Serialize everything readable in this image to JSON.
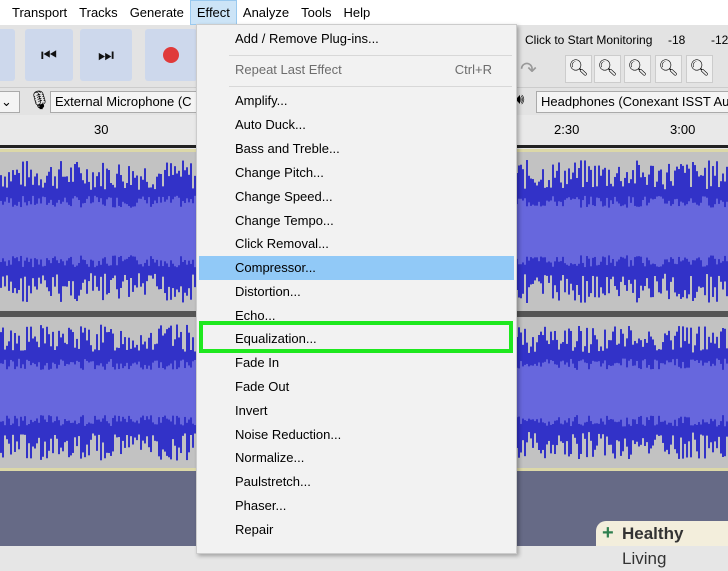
{
  "menubar": {
    "items": [
      "Transport",
      "Tracks",
      "Generate",
      "Effect",
      "Analyze",
      "Tools",
      "Help"
    ],
    "active": "Effect"
  },
  "toolbar": {
    "monitor_label": "Click to Start Monitoring",
    "meter_ticks": [
      "-18",
      "-12"
    ]
  },
  "devices": {
    "input": "External Microphone (C",
    "output": "Headphones (Conexant ISST Au"
  },
  "timeline": {
    "labels": [
      "30",
      "2:30",
      "3:00"
    ]
  },
  "effect_menu": {
    "items": [
      {
        "label": "Add / Remove Plug-ins..."
      },
      {
        "label": "Repeat Last Effect",
        "shortcut": "Ctrl+R",
        "disabled": true
      },
      {
        "label": "Amplify..."
      },
      {
        "label": "Auto Duck..."
      },
      {
        "label": "Bass and Treble..."
      },
      {
        "label": "Change Pitch..."
      },
      {
        "label": "Change Speed..."
      },
      {
        "label": "Change Tempo..."
      },
      {
        "label": "Click Removal..."
      },
      {
        "label": "Compressor...",
        "hovered": true
      },
      {
        "label": "Distortion..."
      },
      {
        "label": "Echo..."
      },
      {
        "label": "Equalization...",
        "highlighted_box": true
      },
      {
        "label": "Fade In"
      },
      {
        "label": "Fade Out"
      },
      {
        "label": "Invert"
      },
      {
        "label": "Noise Reduction..."
      },
      {
        "label": "Normalize..."
      },
      {
        "label": "Paulstretch..."
      },
      {
        "label": "Phaser..."
      },
      {
        "label": "Repair"
      }
    ]
  },
  "watermark": {
    "bold": "Healthy",
    "rest": " Living"
  },
  "colors": {
    "hover": "#91c9f7",
    "highlight_box": "#1ee81e",
    "wave_dark": "#3232c8",
    "wave_light": "#6767dd",
    "track_bg": "#c2c2c2"
  }
}
